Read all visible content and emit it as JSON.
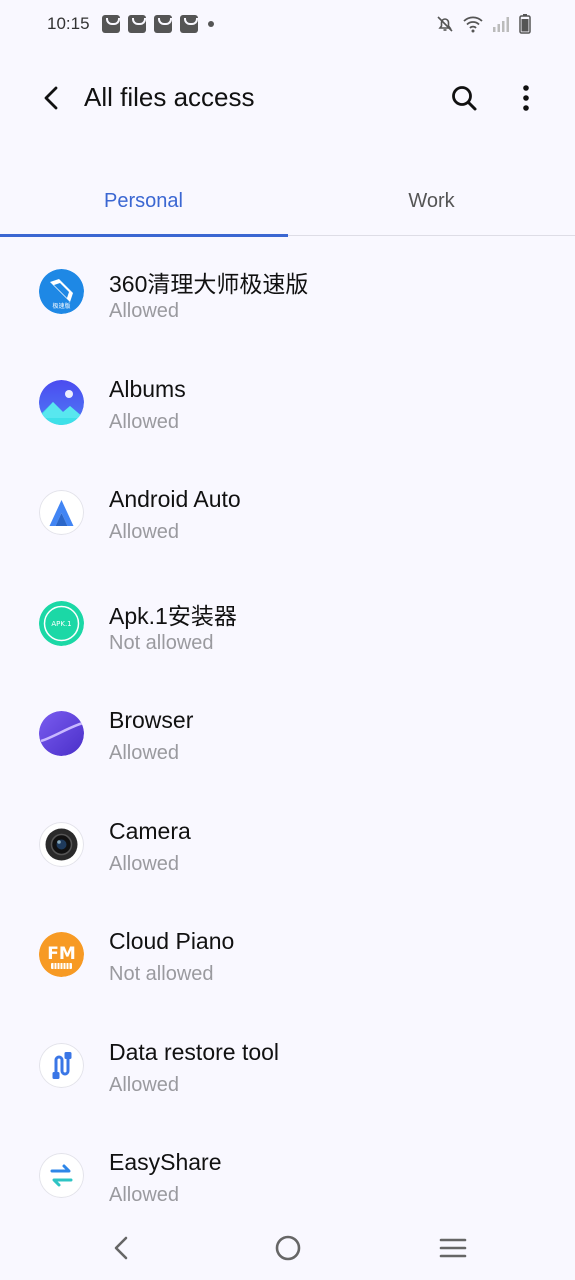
{
  "status_bar": {
    "time": "10:15",
    "notification_count": 4
  },
  "app_bar": {
    "title": "All files access"
  },
  "tabs": [
    {
      "label": "Personal",
      "selected": true
    },
    {
      "label": "Work",
      "selected": false
    }
  ],
  "apps": [
    {
      "name": "360清理大师极速版",
      "status": "Allowed",
      "icon": "cleaner-icon",
      "icon_text": "极速版"
    },
    {
      "name": "Albums",
      "status": "Allowed",
      "icon": "albums-icon"
    },
    {
      "name": "Android Auto",
      "status": "Allowed",
      "icon": "android-auto-icon"
    },
    {
      "name": "Apk.1安装器",
      "status": "Not allowed",
      "icon": "apk-installer-icon",
      "icon_text": "APK.1"
    },
    {
      "name": "Browser",
      "status": "Allowed",
      "icon": "browser-icon"
    },
    {
      "name": "Camera",
      "status": "Allowed",
      "icon": "camera-icon"
    },
    {
      "name": "Cloud Piano",
      "status": "Not allowed",
      "icon": "cloud-piano-icon",
      "icon_text": "FM"
    },
    {
      "name": "Data restore tool",
      "status": "Allowed",
      "icon": "data-restore-icon"
    },
    {
      "name": "EasyShare",
      "status": "Allowed",
      "icon": "easyshare-icon"
    }
  ],
  "colors": {
    "accent": "#3b67d2",
    "background": "#f9f8ff",
    "secondary_text": "#9a9a9f"
  }
}
